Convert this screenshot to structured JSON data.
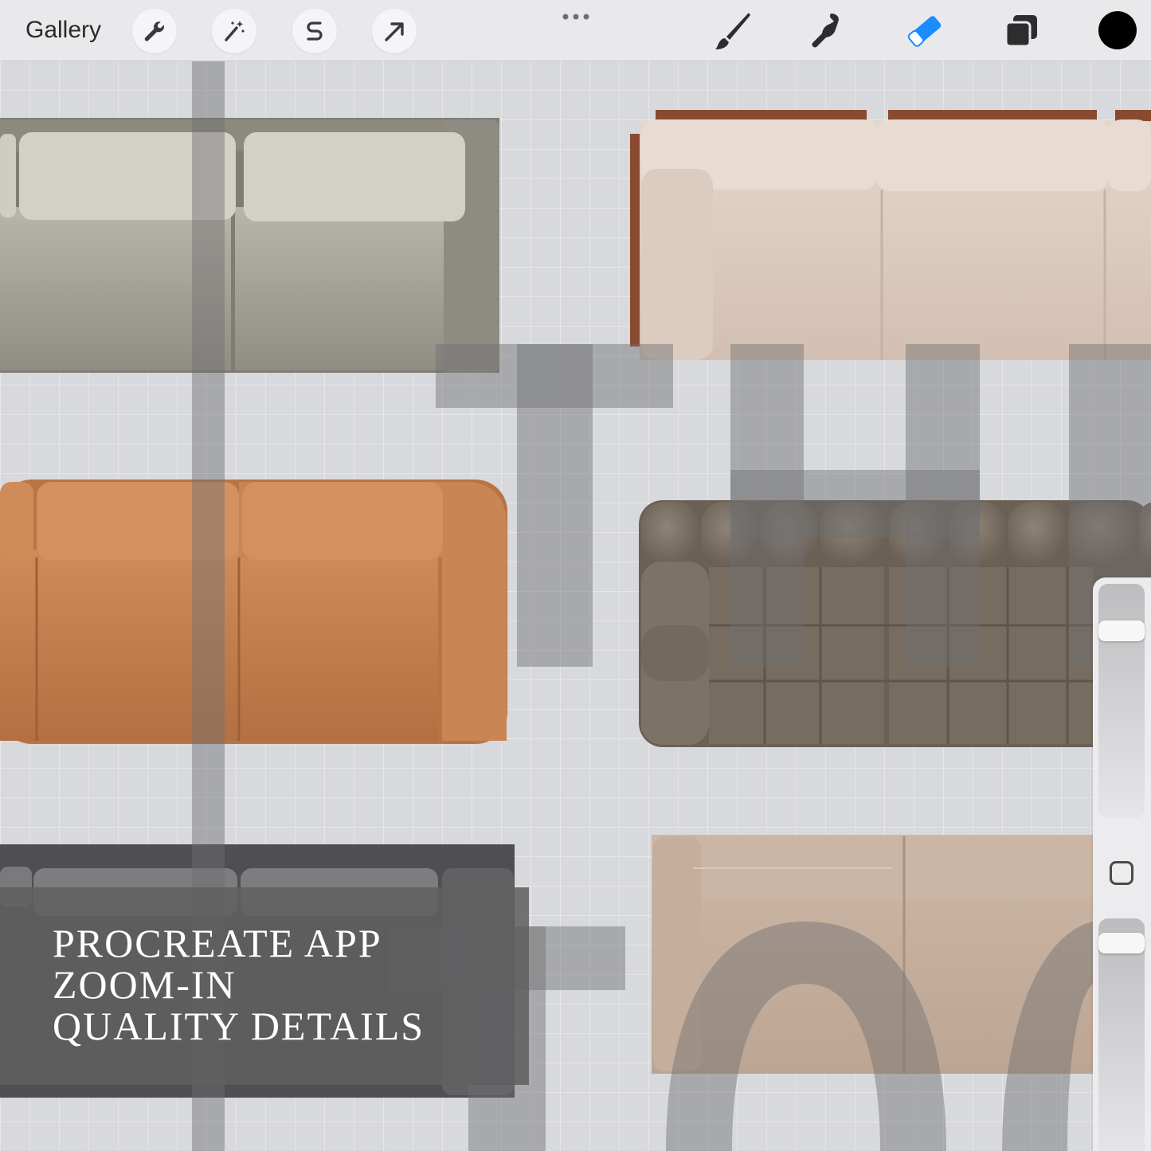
{
  "toolbar": {
    "gallery_label": "Gallery",
    "left_tools": [
      "wrench-icon",
      "magic-wand-icon",
      "selection-s-icon",
      "transform-arrow-icon"
    ],
    "right_tools": [
      "brush-icon",
      "smudge-icon",
      "eraser-icon",
      "layers-icon"
    ],
    "active_tool": "eraser-icon",
    "active_color": "#1a8cff",
    "current_color": "#000000"
  },
  "side_panel": {
    "brush_size_level": 0.1,
    "opacity_level": 0.2
  },
  "caption": {
    "line1": "PROCREATE APP",
    "line2": "ZOOM-IN",
    "line3": "QUALITY DETAILS"
  },
  "canvas_colors": {
    "sofa_gray_linen": "#9d9a90",
    "sofa_blush": "#d9c7bb",
    "sofa_walnut_frame": "#8a4a30",
    "sofa_cognac": "#c27e4f",
    "sofa_boucle": "#7f7467",
    "sofa_charcoal": "#5c5c5e",
    "sofa_taupe": "#c2aa98",
    "overlay_letters": "#6e6e70"
  }
}
